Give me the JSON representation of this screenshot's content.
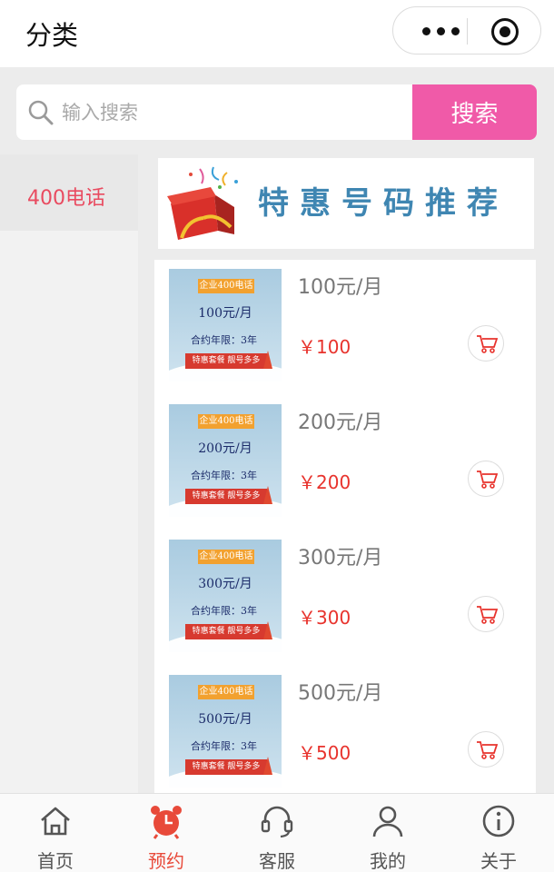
{
  "header": {
    "title": "分类"
  },
  "search": {
    "placeholder": "输入搜索",
    "button_label": "搜索"
  },
  "categories": [
    {
      "label": "400电话",
      "active": true
    }
  ],
  "banner": {
    "text": "特惠号码推荐"
  },
  "products": [
    {
      "name": "100元/月",
      "price": "￥100",
      "thumb": {
        "tag": "企业400电话",
        "price": "100元/月",
        "term": "合约年限：3年",
        "ribbon": "特惠套餐 靓号多多"
      }
    },
    {
      "name": "200元/月",
      "price": "￥200",
      "thumb": {
        "tag": "企业400电话",
        "price": "200元/月",
        "term": "合约年限：3年",
        "ribbon": "特惠套餐 靓号多多"
      }
    },
    {
      "name": "300元/月",
      "price": "￥300",
      "thumb": {
        "tag": "企业400电话",
        "price": "300元/月",
        "term": "合约年限：3年",
        "ribbon": "特惠套餐 靓号多多"
      }
    },
    {
      "name": "500元/月",
      "price": "￥500",
      "thumb": {
        "tag": "企业400电话",
        "price": "500元/月",
        "term": "合约年限：3年",
        "ribbon": "特惠套餐 靓号多多"
      }
    }
  ],
  "tabs": [
    {
      "label": "首页",
      "icon": "home-icon"
    },
    {
      "label": "预约",
      "icon": "alarm-clock-icon",
      "active": true
    },
    {
      "label": "客服",
      "icon": "headset-icon"
    },
    {
      "label": "我的",
      "icon": "user-icon"
    },
    {
      "label": "关于",
      "icon": "info-icon"
    }
  ],
  "colors": {
    "accent": "#f05aa8",
    "price": "#e8332d",
    "active_tab": "#e84a3a",
    "category_active": "#e94b60"
  }
}
